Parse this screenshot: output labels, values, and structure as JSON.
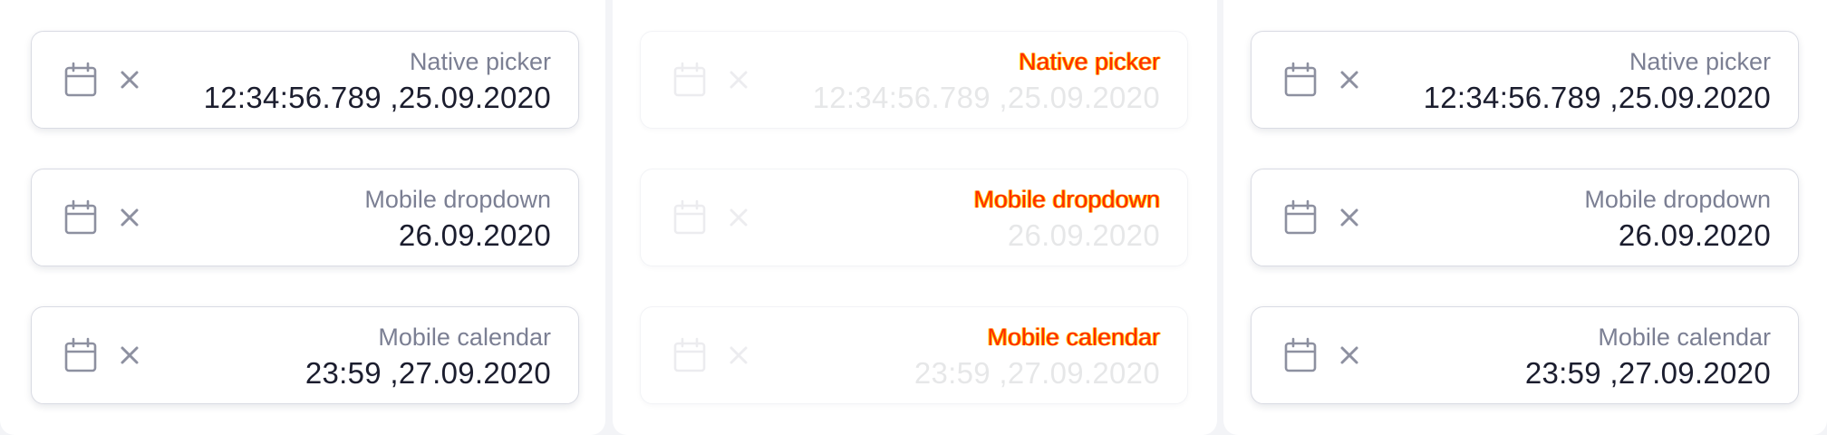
{
  "columns": [
    {
      "state": "enabled",
      "fields": [
        {
          "label": "Native picker",
          "value": "12:34:56.789 ,25.09.2020"
        },
        {
          "label": "Mobile dropdown",
          "value": "26.09.2020"
        },
        {
          "label": "Mobile calendar",
          "value": "23:59 ,27.09.2020"
        }
      ]
    },
    {
      "state": "disabled",
      "fields": [
        {
          "label": "Native picker",
          "value": "12:34:56.789 ,25.09.2020"
        },
        {
          "label": "Mobile dropdown",
          "value": "26.09.2020"
        },
        {
          "label": "Mobile calendar",
          "value": "23:59 ,27.09.2020"
        }
      ]
    },
    {
      "state": "enabled",
      "fields": [
        {
          "label": "Native picker",
          "value": "12:34:56.789 ,25.09.2020"
        },
        {
          "label": "Mobile dropdown",
          "value": "26.09.2020"
        },
        {
          "label": "Mobile calendar",
          "value": "23:59 ,27.09.2020"
        }
      ]
    }
  ],
  "icons": {
    "calendar": "calendar-icon",
    "clear": "close-icon"
  },
  "colors": {
    "label": "#7b7f93",
    "value": "#1b1d2e",
    "icon": "#8d90a0",
    "border": "#d9dbe3",
    "disabled_label": "#ff2a00"
  }
}
